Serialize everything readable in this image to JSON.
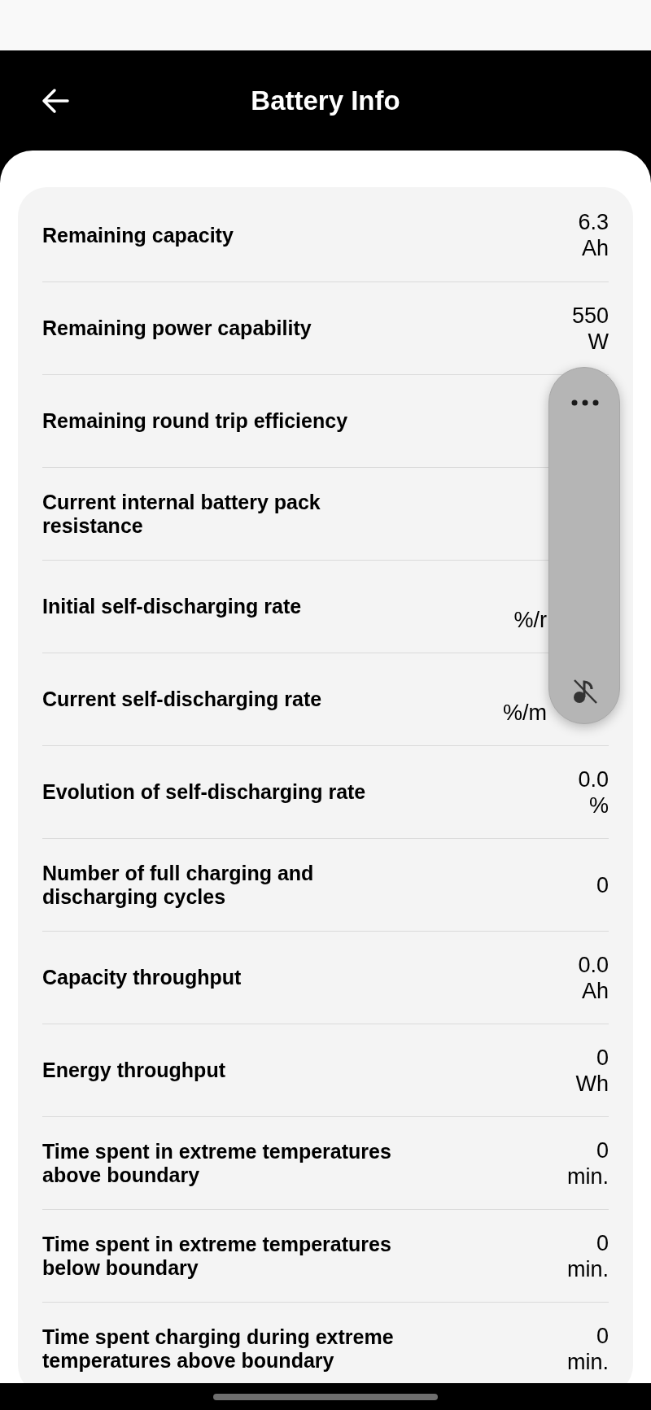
{
  "header": {
    "title": "Battery Info"
  },
  "rows": [
    {
      "label": "Remaining capacity",
      "value": "6.3",
      "unit": "Ah"
    },
    {
      "label": "Remaining power capability",
      "value": "550",
      "unit": "W"
    },
    {
      "label": "Remaining round trip efficiency"
    },
    {
      "label": "Current internal battery pack resistance"
    },
    {
      "label": "Initial self-discharging rate",
      "unit": "%/r",
      "kind": "covered"
    },
    {
      "label": "Current self-discharging rate",
      "unit": "%/m",
      "kind": "covered"
    },
    {
      "label": "Evolution of self-discharging rate",
      "value": "0.0",
      "unit": "%"
    },
    {
      "label": "Number of full charging and discharging cycles",
      "value": "0"
    },
    {
      "label": "Capacity throughput",
      "value": "0.0",
      "unit": "Ah"
    },
    {
      "label": "Energy throughput",
      "value": "0",
      "unit": "Wh"
    },
    {
      "label": "Time spent in extreme temperatures above boundary",
      "value": "0",
      "unit": "min."
    },
    {
      "label": "Time spent in extreme temperatures below boundary",
      "value": "0",
      "unit": "min."
    },
    {
      "label": "Time spent charging during extreme temperatures above boundary",
      "value": "0",
      "unit": "min."
    }
  ]
}
